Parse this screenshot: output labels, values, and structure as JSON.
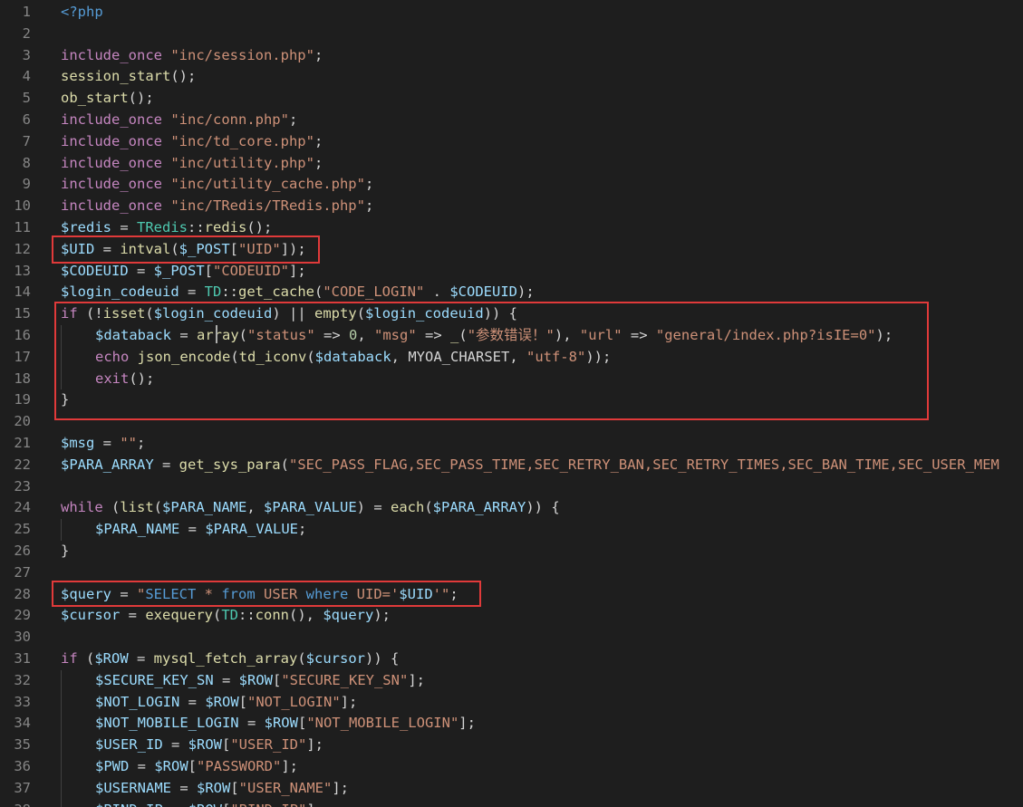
{
  "editor": {
    "language": "php",
    "theme_colors": {
      "background": "#1e1e1e",
      "line_number": "#858585",
      "keyword": "#c586c0",
      "function": "#dcdcaa",
      "variable": "#9cdcfe",
      "string": "#ce9178",
      "class": "#4ec9b0",
      "number": "#b5cea8",
      "highlight_box": "#e03a3a"
    },
    "lines": [
      {
        "n": "1",
        "indent": 0,
        "tokens": [
          [
            "php",
            "<?php"
          ]
        ]
      },
      {
        "n": "2",
        "indent": 0,
        "tokens": []
      },
      {
        "n": "3",
        "indent": 0,
        "tokens": [
          [
            "kw",
            "include_once"
          ],
          [
            "plain",
            " "
          ],
          [
            "str",
            "\"inc/session.php\""
          ],
          [
            "plain",
            ";"
          ]
        ]
      },
      {
        "n": "4",
        "indent": 0,
        "tokens": [
          [
            "func",
            "session_start"
          ],
          [
            "plain",
            "();"
          ]
        ]
      },
      {
        "n": "5",
        "indent": 0,
        "tokens": [
          [
            "func",
            "ob_start"
          ],
          [
            "plain",
            "();"
          ]
        ]
      },
      {
        "n": "6",
        "indent": 0,
        "tokens": [
          [
            "kw",
            "include_once"
          ],
          [
            "plain",
            " "
          ],
          [
            "str",
            "\"inc/conn.php\""
          ],
          [
            "plain",
            ";"
          ]
        ]
      },
      {
        "n": "7",
        "indent": 0,
        "tokens": [
          [
            "kw",
            "include_once"
          ],
          [
            "plain",
            " "
          ],
          [
            "str",
            "\"inc/td_core.php\""
          ],
          [
            "plain",
            ";"
          ]
        ]
      },
      {
        "n": "8",
        "indent": 0,
        "tokens": [
          [
            "kw",
            "include_once"
          ],
          [
            "plain",
            " "
          ],
          [
            "str",
            "\"inc/utility.php\""
          ],
          [
            "plain",
            ";"
          ]
        ]
      },
      {
        "n": "9",
        "indent": 0,
        "tokens": [
          [
            "kw",
            "include_once"
          ],
          [
            "plain",
            " "
          ],
          [
            "str",
            "\"inc/utility_cache.php\""
          ],
          [
            "plain",
            ";"
          ]
        ]
      },
      {
        "n": "10",
        "indent": 0,
        "tokens": [
          [
            "kw",
            "include_once"
          ],
          [
            "plain",
            " "
          ],
          [
            "str",
            "\"inc/TRedis/TRedis.php\""
          ],
          [
            "plain",
            ";"
          ]
        ]
      },
      {
        "n": "11",
        "indent": 0,
        "tokens": [
          [
            "var",
            "$redis"
          ],
          [
            "plain",
            " = "
          ],
          [
            "class",
            "TRedis"
          ],
          [
            "plain",
            "::"
          ],
          [
            "func",
            "redis"
          ],
          [
            "plain",
            "();"
          ]
        ]
      },
      {
        "n": "12",
        "indent": 0,
        "tokens": [
          [
            "var",
            "$UID"
          ],
          [
            "plain",
            " = "
          ],
          [
            "func",
            "intval"
          ],
          [
            "plain",
            "("
          ],
          [
            "var",
            "$_POST"
          ],
          [
            "plain",
            "["
          ],
          [
            "str",
            "\"UID\""
          ],
          [
            "plain",
            "]);"
          ]
        ]
      },
      {
        "n": "13",
        "indent": 0,
        "tokens": [
          [
            "var",
            "$CODEUID"
          ],
          [
            "plain",
            " = "
          ],
          [
            "var",
            "$_POST"
          ],
          [
            "plain",
            "["
          ],
          [
            "str",
            "\"CODEUID\""
          ],
          [
            "plain",
            "];"
          ]
        ]
      },
      {
        "n": "14",
        "indent": 0,
        "tokens": [
          [
            "var",
            "$login_codeuid"
          ],
          [
            "plain",
            " = "
          ],
          [
            "class",
            "TD"
          ],
          [
            "plain",
            "::"
          ],
          [
            "func",
            "get_cache"
          ],
          [
            "plain",
            "("
          ],
          [
            "str",
            "\"CODE_LOGIN\""
          ],
          [
            "plain",
            " . "
          ],
          [
            "var",
            "$CODEUID"
          ],
          [
            "plain",
            ");"
          ]
        ]
      },
      {
        "n": "15",
        "indent": 0,
        "tokens": [
          [
            "kw",
            "if"
          ],
          [
            "plain",
            " (!"
          ],
          [
            "func",
            "isset"
          ],
          [
            "plain",
            "("
          ],
          [
            "var",
            "$login_codeuid"
          ],
          [
            "plain",
            ") || "
          ],
          [
            "func",
            "empty"
          ],
          [
            "plain",
            "("
          ],
          [
            "var",
            "$login_codeuid"
          ],
          [
            "plain",
            ")) {"
          ]
        ]
      },
      {
        "n": "16",
        "indent": 1,
        "tokens": [
          [
            "var",
            "$databack"
          ],
          [
            "plain",
            " = "
          ],
          [
            "func",
            "array"
          ],
          [
            "plain",
            "("
          ],
          [
            "str",
            "\"status\""
          ],
          [
            "plain",
            " => "
          ],
          [
            "num",
            "0"
          ],
          [
            "plain",
            ", "
          ],
          [
            "str",
            "\"msg\""
          ],
          [
            "plain",
            " => "
          ],
          [
            "func",
            "_"
          ],
          [
            "plain",
            "("
          ],
          [
            "str",
            "\"参数错误！\""
          ],
          [
            "plain",
            "), "
          ],
          [
            "str",
            "\"url\""
          ],
          [
            "plain",
            " => "
          ],
          [
            "str",
            "\"general/index.php?isIE=0\""
          ],
          [
            "plain",
            ");"
          ]
        ]
      },
      {
        "n": "17",
        "indent": 1,
        "tokens": [
          [
            "kw",
            "echo"
          ],
          [
            "plain",
            " "
          ],
          [
            "func",
            "json_encode"
          ],
          [
            "plain",
            "("
          ],
          [
            "func",
            "td_iconv"
          ],
          [
            "plain",
            "("
          ],
          [
            "var",
            "$databack"
          ],
          [
            "plain",
            ", MYOA_CHARSET, "
          ],
          [
            "str",
            "\"utf-8\""
          ],
          [
            "plain",
            "));"
          ]
        ]
      },
      {
        "n": "18",
        "indent": 1,
        "tokens": [
          [
            "kw",
            "exit"
          ],
          [
            "plain",
            "();"
          ]
        ]
      },
      {
        "n": "19",
        "indent": 0,
        "tokens": [
          [
            "plain",
            "}"
          ]
        ]
      },
      {
        "n": "20",
        "indent": 0,
        "tokens": []
      },
      {
        "n": "21",
        "indent": 0,
        "tokens": [
          [
            "var",
            "$msg"
          ],
          [
            "plain",
            " = "
          ],
          [
            "str",
            "\"\""
          ],
          [
            "plain",
            ";"
          ]
        ]
      },
      {
        "n": "22",
        "indent": 0,
        "tokens": [
          [
            "var",
            "$PARA_ARRAY"
          ],
          [
            "plain",
            " = "
          ],
          [
            "func",
            "get_sys_para"
          ],
          [
            "plain",
            "("
          ],
          [
            "str",
            "\"SEC_PASS_FLAG,SEC_PASS_TIME,SEC_RETRY_BAN,SEC_RETRY_TIMES,SEC_BAN_TIME,SEC_USER_MEM"
          ]
        ]
      },
      {
        "n": "23",
        "indent": 0,
        "tokens": []
      },
      {
        "n": "24",
        "indent": 0,
        "tokens": [
          [
            "kw",
            "while"
          ],
          [
            "plain",
            " ("
          ],
          [
            "func",
            "list"
          ],
          [
            "plain",
            "("
          ],
          [
            "var",
            "$PARA_NAME"
          ],
          [
            "plain",
            ", "
          ],
          [
            "var",
            "$PARA_VALUE"
          ],
          [
            "plain",
            ") = "
          ],
          [
            "func",
            "each"
          ],
          [
            "plain",
            "("
          ],
          [
            "var",
            "$PARA_ARRAY"
          ],
          [
            "plain",
            ")) {"
          ]
        ]
      },
      {
        "n": "25",
        "indent": 1,
        "tokens": [
          [
            "var",
            "$PARA_NAME"
          ],
          [
            "plain",
            " = "
          ],
          [
            "var",
            "$PARA_VALUE"
          ],
          [
            "plain",
            ";"
          ]
        ]
      },
      {
        "n": "26",
        "indent": 0,
        "tokens": [
          [
            "plain",
            "}"
          ]
        ]
      },
      {
        "n": "27",
        "indent": 0,
        "tokens": []
      },
      {
        "n": "28",
        "indent": 0,
        "tokens": [
          [
            "var",
            "$query"
          ],
          [
            "plain",
            " = "
          ],
          [
            "str",
            "\""
          ],
          [
            "sqlkw",
            "SELECT"
          ],
          [
            "str",
            " * "
          ],
          [
            "sqlkw",
            "from"
          ],
          [
            "str",
            " USER "
          ],
          [
            "sqlkw",
            "where"
          ],
          [
            "str",
            " UID='"
          ],
          [
            "var",
            "$UID"
          ],
          [
            "str",
            "'\""
          ],
          [
            "plain",
            ";"
          ]
        ]
      },
      {
        "n": "29",
        "indent": 0,
        "tokens": [
          [
            "var",
            "$cursor"
          ],
          [
            "plain",
            " = "
          ],
          [
            "func",
            "exequery"
          ],
          [
            "plain",
            "("
          ],
          [
            "class",
            "TD"
          ],
          [
            "plain",
            "::"
          ],
          [
            "func",
            "conn"
          ],
          [
            "plain",
            "(), "
          ],
          [
            "var",
            "$query"
          ],
          [
            "plain",
            ");"
          ]
        ]
      },
      {
        "n": "30",
        "indent": 0,
        "tokens": []
      },
      {
        "n": "31",
        "indent": 0,
        "tokens": [
          [
            "kw",
            "if"
          ],
          [
            "plain",
            " ("
          ],
          [
            "var",
            "$ROW"
          ],
          [
            "plain",
            " = "
          ],
          [
            "func",
            "mysql_fetch_array"
          ],
          [
            "plain",
            "("
          ],
          [
            "var",
            "$cursor"
          ],
          [
            "plain",
            ")) {"
          ]
        ]
      },
      {
        "n": "32",
        "indent": 1,
        "tokens": [
          [
            "var",
            "$SECURE_KEY_SN"
          ],
          [
            "plain",
            " = "
          ],
          [
            "var",
            "$ROW"
          ],
          [
            "plain",
            "["
          ],
          [
            "str",
            "\"SECURE_KEY_SN\""
          ],
          [
            "plain",
            "];"
          ]
        ]
      },
      {
        "n": "33",
        "indent": 1,
        "tokens": [
          [
            "var",
            "$NOT_LOGIN"
          ],
          [
            "plain",
            " = "
          ],
          [
            "var",
            "$ROW"
          ],
          [
            "plain",
            "["
          ],
          [
            "str",
            "\"NOT_LOGIN\""
          ],
          [
            "plain",
            "];"
          ]
        ]
      },
      {
        "n": "34",
        "indent": 1,
        "tokens": [
          [
            "var",
            "$NOT_MOBILE_LOGIN"
          ],
          [
            "plain",
            " = "
          ],
          [
            "var",
            "$ROW"
          ],
          [
            "plain",
            "["
          ],
          [
            "str",
            "\"NOT_MOBILE_LOGIN\""
          ],
          [
            "plain",
            "];"
          ]
        ]
      },
      {
        "n": "35",
        "indent": 1,
        "tokens": [
          [
            "var",
            "$USER_ID"
          ],
          [
            "plain",
            " = "
          ],
          [
            "var",
            "$ROW"
          ],
          [
            "plain",
            "["
          ],
          [
            "str",
            "\"USER_ID\""
          ],
          [
            "plain",
            "];"
          ]
        ]
      },
      {
        "n": "36",
        "indent": 1,
        "tokens": [
          [
            "var",
            "$PWD"
          ],
          [
            "plain",
            " = "
          ],
          [
            "var",
            "$ROW"
          ],
          [
            "plain",
            "["
          ],
          [
            "str",
            "\"PASSWORD\""
          ],
          [
            "plain",
            "];"
          ]
        ]
      },
      {
        "n": "37",
        "indent": 1,
        "tokens": [
          [
            "var",
            "$USERNAME"
          ],
          [
            "plain",
            " = "
          ],
          [
            "var",
            "$ROW"
          ],
          [
            "plain",
            "["
          ],
          [
            "str",
            "\"USER_NAME\""
          ],
          [
            "plain",
            "];"
          ]
        ]
      },
      {
        "n": "38",
        "indent": 1,
        "tokens": [
          [
            "var",
            "$BIND_IP"
          ],
          [
            "plain",
            " = "
          ],
          [
            "var",
            "$ROW"
          ],
          [
            "plain",
            "["
          ],
          [
            "str",
            "\"BIND_IP\""
          ],
          [
            "plain",
            "];"
          ]
        ]
      }
    ],
    "highlights": [
      {
        "name": "uid-intval-highlight",
        "lines": "12"
      },
      {
        "name": "login-codeuid-check-highlight",
        "lines": "15-19"
      },
      {
        "name": "sql-query-highlight",
        "lines": "28"
      }
    ]
  }
}
